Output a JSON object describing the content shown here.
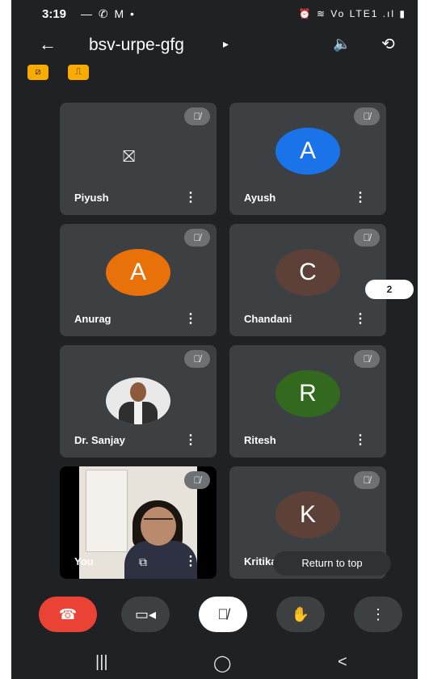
{
  "status_bar": {
    "time": "3:19",
    "left_icons": "— ✆ M •",
    "right_icons": "⏰ ≋ Vo LTE1 .ıl ▮"
  },
  "header": {
    "title": "bsv-urpe-gfg",
    "title_caret": "▸",
    "back_icon": "←",
    "speaker_icon": "🔈",
    "switch_camera_icon": "⟲"
  },
  "badges": [
    {
      "icon": "⧄",
      "color": "#f9ab00"
    },
    {
      "icon": "⎍",
      "color": "#f9ab00"
    }
  ],
  "participants": [
    {
      "name": "Piyush",
      "type": "camera-off",
      "icon": "⛝",
      "muted": true
    },
    {
      "name": "Ayush",
      "type": "initial",
      "initial": "A",
      "color": "#1a73e8",
      "muted": true
    },
    {
      "name": "Anurag",
      "type": "initial",
      "initial": "A",
      "color": "#e8710a",
      "muted": true
    },
    {
      "name": "Chandani",
      "type": "initial",
      "initial": "C",
      "color": "#5d4037",
      "muted": true
    },
    {
      "name": "Dr. Sanjay",
      "type": "photo",
      "muted": true
    },
    {
      "name": "Ritesh",
      "type": "initial",
      "initial": "R",
      "color": "#33691e",
      "muted": true
    },
    {
      "name": "You",
      "type": "self-video",
      "muted": true
    },
    {
      "name": "Kritika",
      "type": "initial",
      "initial": "K",
      "color": "#5d4037",
      "muted": true
    }
  ],
  "tile_menu_icon": "⋮",
  "mic_off_icon": "🎙̸",
  "page_indicator": "2",
  "return_to_top": "Return to top",
  "controls": [
    {
      "name": "end-call",
      "icon": "☎",
      "color": "#ea4335"
    },
    {
      "name": "camera",
      "icon": "▭◂",
      "color": "#3c4043"
    },
    {
      "name": "mic",
      "icon": "🎙̸",
      "color": "#ffffff"
    },
    {
      "name": "raise-hand",
      "icon": "✋",
      "color": "#3c4043"
    },
    {
      "name": "more-options",
      "icon": "⋮",
      "color": "#3c4043"
    }
  ],
  "nav": {
    "recents": "|||",
    "home": "◯",
    "back": "<"
  }
}
